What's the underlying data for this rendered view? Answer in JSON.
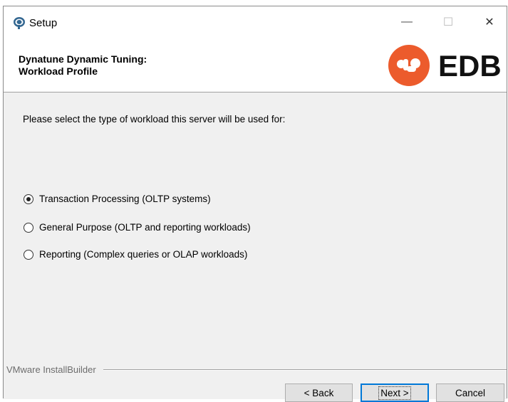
{
  "window": {
    "title": "Setup",
    "app_icon": "postgresql-elephant-icon",
    "controls": {
      "minimize": "—",
      "maximize": "☐",
      "close": "✕"
    }
  },
  "header": {
    "title_line1": "Dynatune Dynamic Tuning:",
    "title_line2": "Workload Profile",
    "logo_text": "EDB",
    "logo_color": "#ec5b2c"
  },
  "content": {
    "prompt": "Please select the type of workload this server will be used for:",
    "options": [
      {
        "label": "Transaction Processing (OLTP systems)",
        "selected": true
      },
      {
        "label": "General Purpose (OLTP and reporting workloads)",
        "selected": false
      },
      {
        "label": "Reporting (Complex queries or OLAP workloads)",
        "selected": false
      }
    ]
  },
  "footer": {
    "builder_label": "VMware InstallBuilder",
    "back_label": "< Back",
    "next_label": "Next >",
    "cancel_label": "Cancel"
  }
}
